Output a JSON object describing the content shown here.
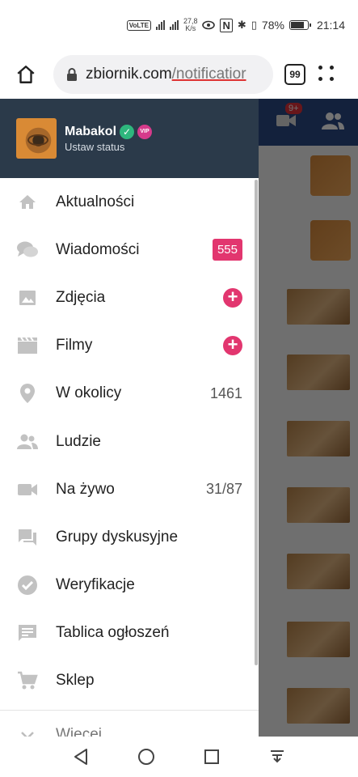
{
  "status_bar": {
    "volte": "VoLTE",
    "net_speed": "27,8",
    "net_unit": "K/s",
    "battery": "78%",
    "time": "21:14"
  },
  "browser": {
    "url_host": "zbiornik.com",
    "url_path": "/notificatior",
    "tab_count": "99"
  },
  "drawer": {
    "user": {
      "name": "Mabakol",
      "status": "Ustaw status",
      "vip_label": "VIP"
    },
    "menu": [
      {
        "label": "Aktualności",
        "icon": "home-icon"
      },
      {
        "label": "Wiadomości",
        "icon": "chat-icon",
        "badge": "555"
      },
      {
        "label": "Zdjęcia",
        "icon": "image-icon",
        "action": "+"
      },
      {
        "label": "Filmy",
        "icon": "film-icon",
        "action": "+"
      },
      {
        "label": "W okolicy",
        "icon": "location-icon",
        "count": "1461"
      },
      {
        "label": "Ludzie",
        "icon": "people-icon"
      },
      {
        "label": "Na żywo",
        "icon": "video-camera-icon",
        "count": "31/87"
      },
      {
        "label": "Grupy dyskusyjne",
        "icon": "forum-icon"
      },
      {
        "label": "Weryfikacje",
        "icon": "check-circle-icon"
      },
      {
        "label": "Tablica ogłoszeń",
        "icon": "message-board-icon"
      },
      {
        "label": "Sklep",
        "icon": "cart-icon"
      },
      {
        "label": "Więcej",
        "icon": "chevron-down-icon"
      }
    ]
  },
  "background_page": {
    "notification_badge": "9+"
  },
  "colors": {
    "drawer_header": "#2b3a4a",
    "accent_pink": "#e2366f",
    "verified_green": "#2eb67d",
    "top_bar_blue": "#2c4a86"
  }
}
